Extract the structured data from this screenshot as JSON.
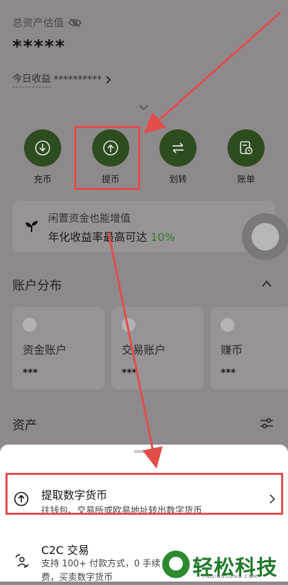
{
  "header": {
    "total_label": "总资产估值",
    "total_value": "*****",
    "today_label": "今日收益",
    "today_value": "**********"
  },
  "actions": [
    {
      "label": "充币",
      "icon": "deposit-icon"
    },
    {
      "label": "提币",
      "icon": "withdraw-icon"
    },
    {
      "label": "划转",
      "icon": "transfer-icon"
    },
    {
      "label": "账单",
      "icon": "bill-icon"
    }
  ],
  "promo": {
    "title": "闲置资金也能增值",
    "text": "年化收益率最高可达",
    "rate": "10%"
  },
  "accounts": {
    "title": "账户分布",
    "cards": [
      {
        "name": "资金账户",
        "value": "***"
      },
      {
        "name": "交易账户",
        "value": "***"
      },
      {
        "name": "赚币",
        "value": "***"
      }
    ]
  },
  "assets": {
    "title": "资产"
  },
  "sheet": {
    "options": [
      {
        "title": "提取数字货币",
        "subtitle": "往钱包、交易所或欧易地址转出数字货币"
      },
      {
        "title": "C2C 交易",
        "subtitle": "支持 100+ 付款方式，0 手续费，买卖数字货币"
      }
    ]
  },
  "watermark": {
    "text": "轻松科技",
    "sub": "YNQINGSONG.COM"
  },
  "colors": {
    "accent_red": "#e24d4a",
    "action_green": "#2e4d1f",
    "rate_green": "#2e7d1e"
  }
}
